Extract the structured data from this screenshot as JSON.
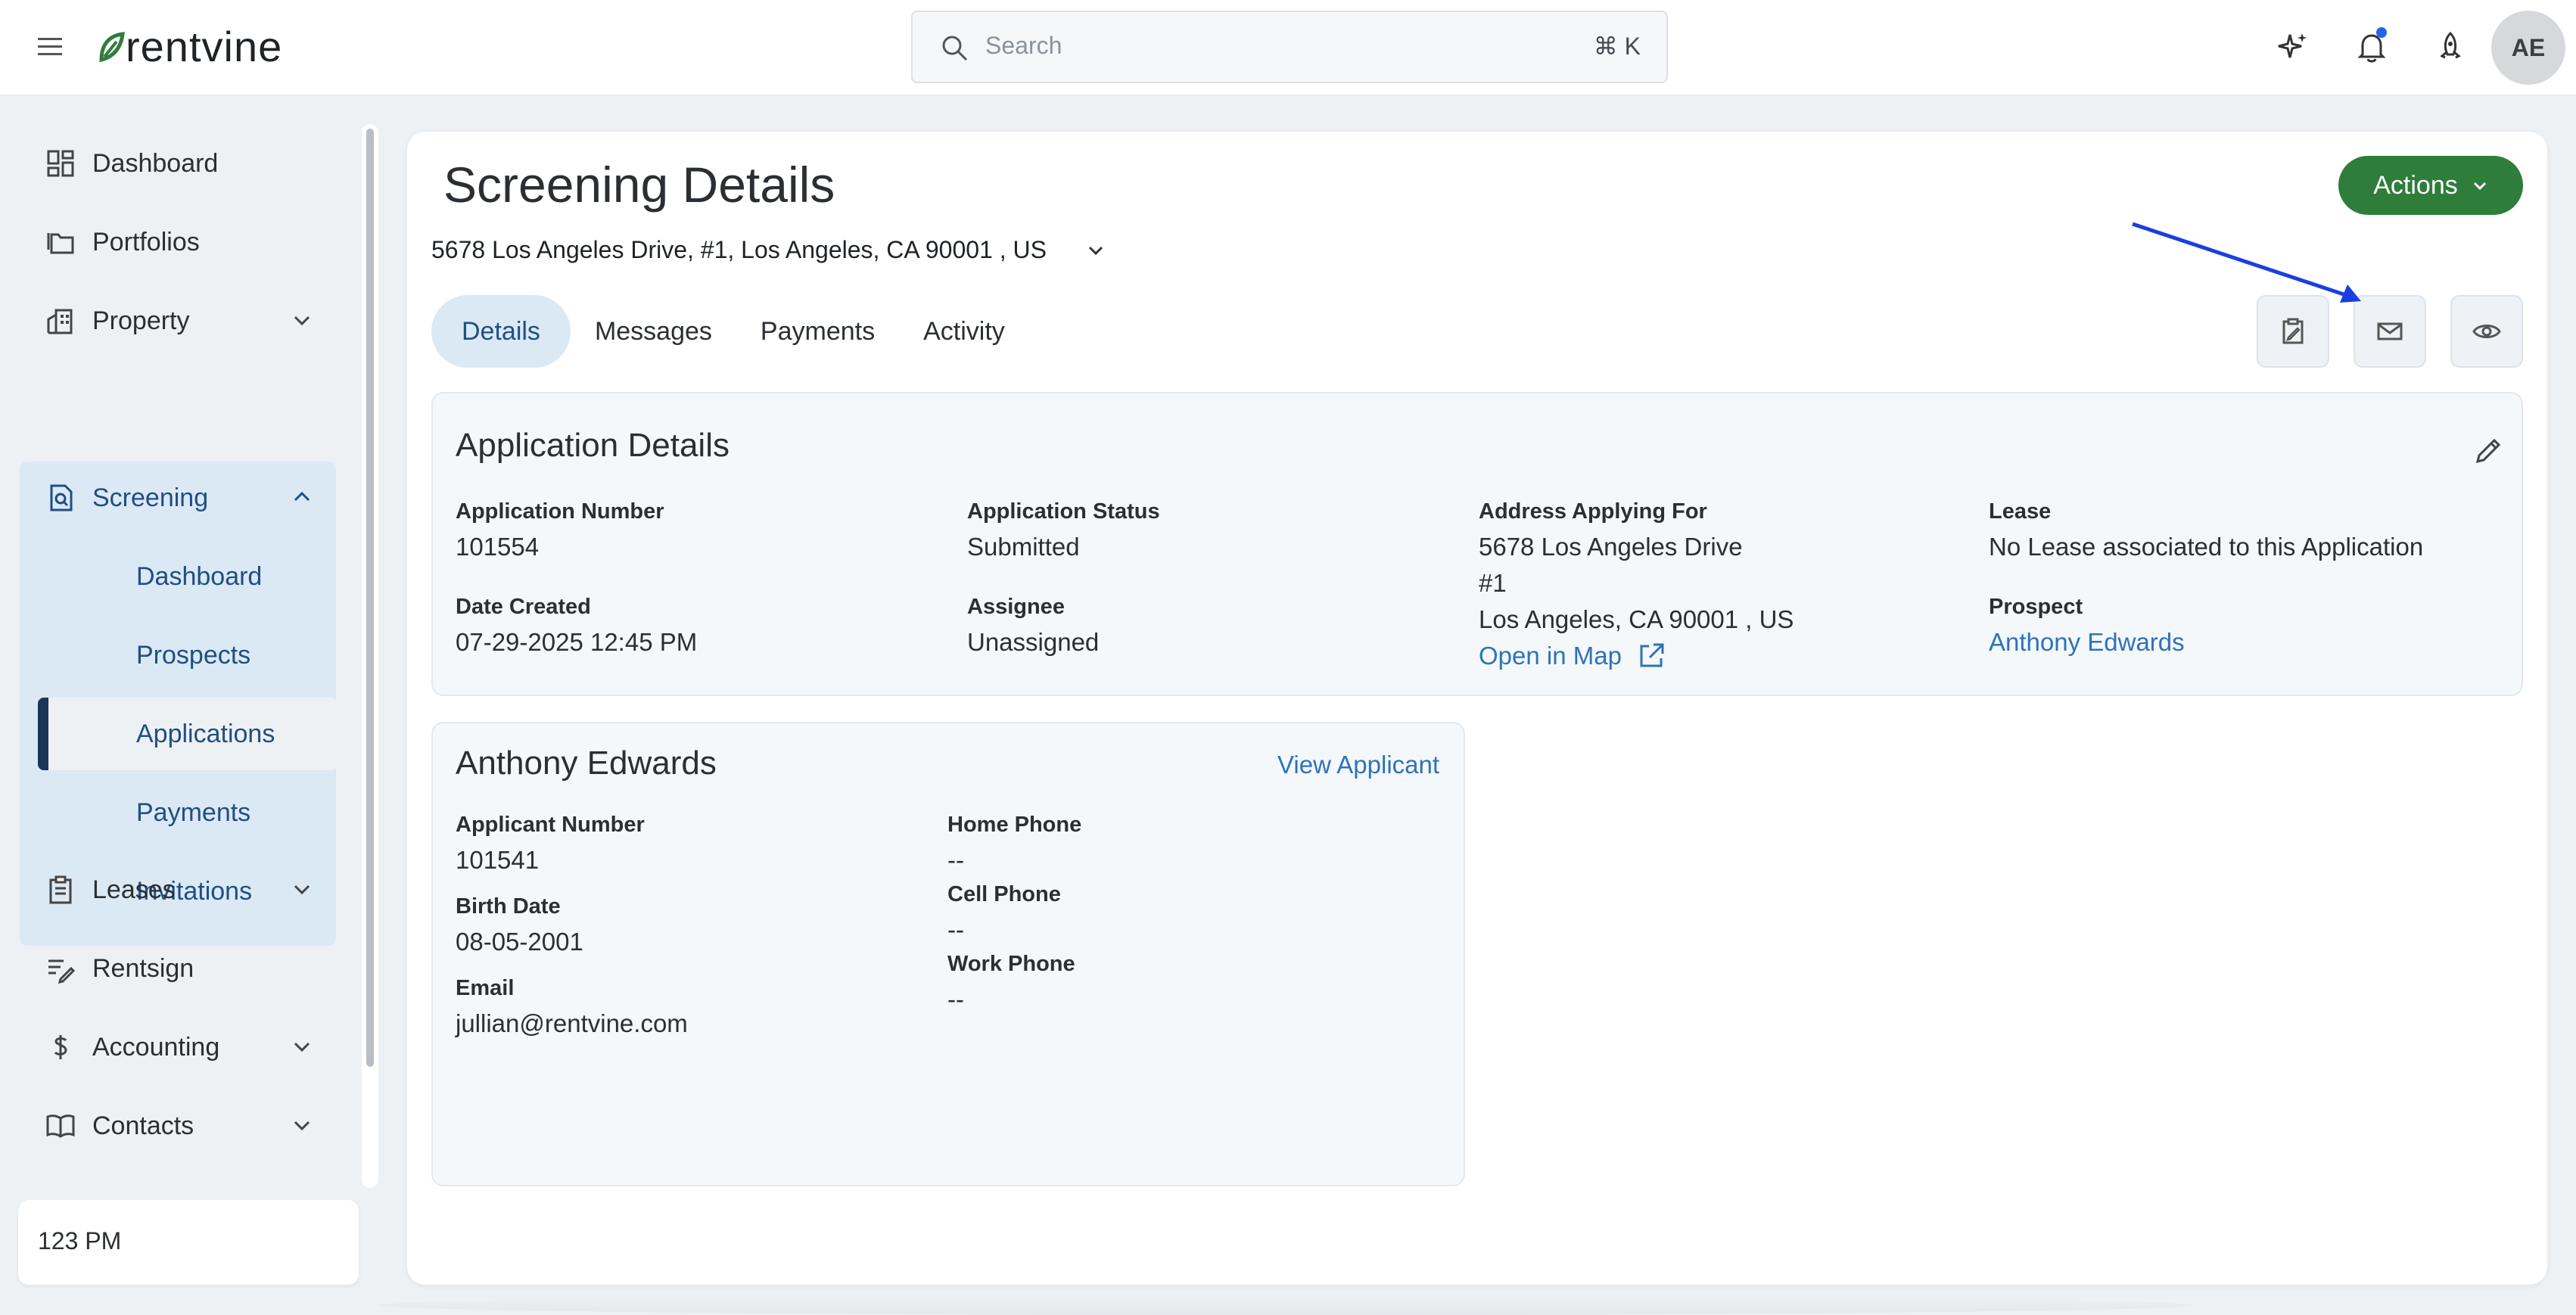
{
  "app": {
    "logo_text": "rentvine",
    "brand_color": "#2e7d3b"
  },
  "search": {
    "placeholder": "Search",
    "shortcut": "⌘ K"
  },
  "topbar": {
    "avatar_initials": "AE",
    "icons": [
      "sparkle-icon",
      "bell-icon",
      "rocket-icon"
    ]
  },
  "sidebar": {
    "items": [
      {
        "label": "Dashboard",
        "icon": "grid-icon"
      },
      {
        "label": "Portfolios",
        "icon": "folders-icon"
      },
      {
        "label": "Property",
        "icon": "building-icon"
      },
      {
        "label": "Screening",
        "icon": "doc-search-icon"
      },
      {
        "label": "Leases",
        "icon": "clipboard-icon"
      },
      {
        "label": "Rentsign",
        "icon": "signature-icon"
      },
      {
        "label": "Accounting",
        "icon": "dollar-icon"
      },
      {
        "label": "Contacts",
        "icon": "book-icon"
      }
    ],
    "screening_sub": [
      "Dashboard",
      "Prospects",
      "Applications",
      "Payments",
      "Invitations"
    ],
    "active_sub": "Applications",
    "clock": "123 PM"
  },
  "page": {
    "title": "Screening Details",
    "address": "5678 Los Angeles Drive, #1, Los Angeles, CA 90001 , US",
    "actions_label": "Actions",
    "tabs": [
      "Details",
      "Messages",
      "Payments",
      "Activity"
    ],
    "active_tab": "Details"
  },
  "application": {
    "title": "Application Details",
    "number_label": "Application Number",
    "number": "101554",
    "status_label": "Application Status",
    "status": "Submitted",
    "address_label": "Address Applying For",
    "address_line1": "5678 Los Angeles Drive",
    "address_line2": "#1",
    "address_line3": "Los Angeles, CA 90001 , US",
    "map_link": "Open in Map",
    "lease_label": "Lease",
    "lease": "No Lease associated to this Application",
    "created_label": "Date Created",
    "created": "07-29-2025 12:45 PM",
    "assignee_label": "Assignee",
    "assignee": "Unassigned",
    "prospect_label": "Prospect",
    "prospect": "Anthony Edwards"
  },
  "applicant": {
    "name": "Anthony Edwards",
    "view_link": "View Applicant",
    "number_label": "Applicant Number",
    "number": "101541",
    "birth_label": "Birth Date",
    "birth": "08-05-2001",
    "email_label": "Email",
    "email": "jullian@rentvine.com",
    "home_label": "Home Phone",
    "home": "--",
    "cell_label": "Cell Phone",
    "cell": "--",
    "work_label": "Work Phone",
    "work": "--"
  }
}
